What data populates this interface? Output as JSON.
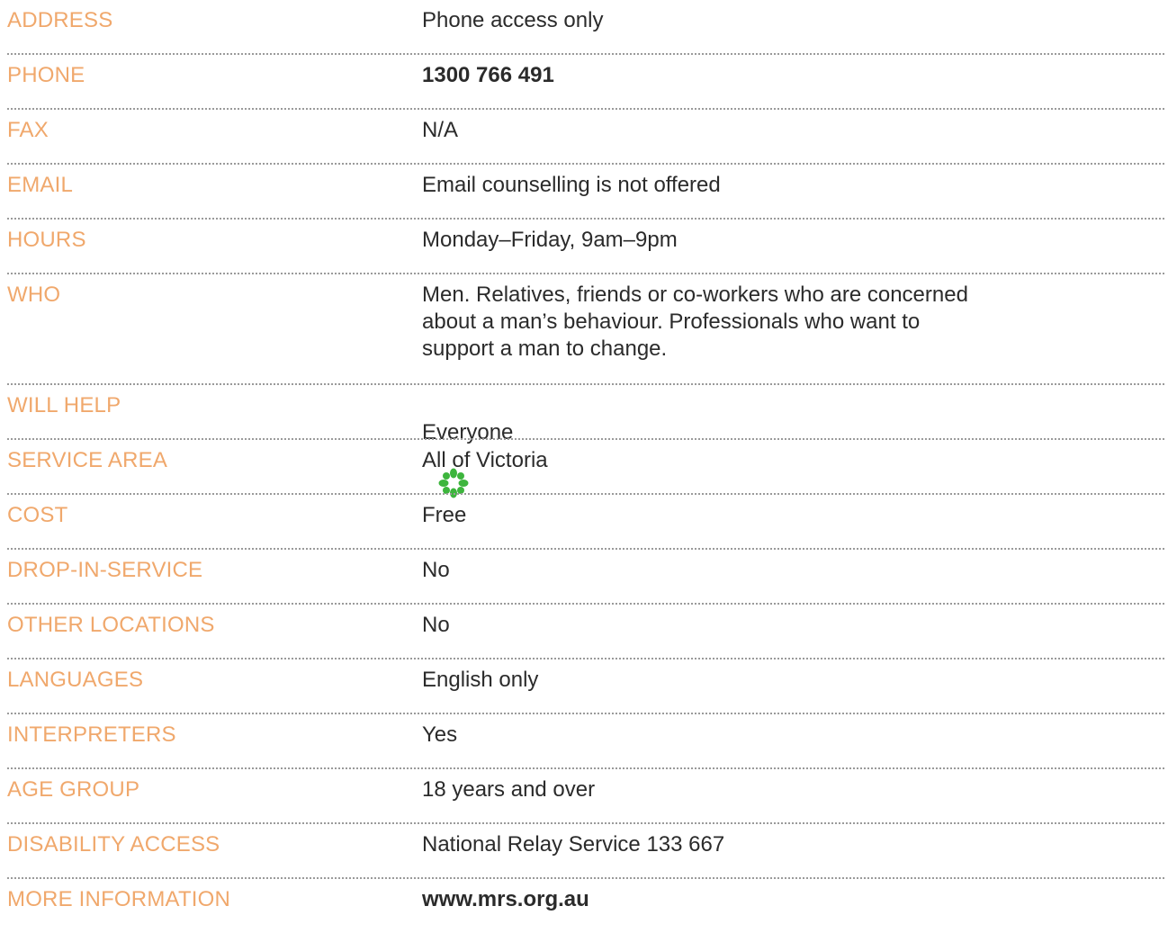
{
  "colors": {
    "label": "#f0a86c",
    "value": "#2b2b2b",
    "separator": "#9a9a9a",
    "icon": "#3db53d"
  },
  "rows": [
    {
      "label": "ADDRESS",
      "value": "Phone access only"
    },
    {
      "label": "PHONE",
      "value": "1300 766 491"
    },
    {
      "label": "FAX",
      "value": "N/A"
    },
    {
      "label": "EMAIL",
      "value": "Email counselling is not offered"
    },
    {
      "label": "HOURS",
      "value": "Monday–Friday, 9am–9pm"
    },
    {
      "label": "WHO",
      "value": "Men. Relatives, friends or co-workers who are concerned\nabout a man’s behaviour. Professionals who want to\nsupport a man to change."
    },
    {
      "label": "WILL HELP",
      "value": "Everyone",
      "icon": "green-asterisk-flower-icon"
    },
    {
      "label": "SERVICE AREA",
      "value": "All of Victoria"
    },
    {
      "label": "COST",
      "value": "Free"
    },
    {
      "label": "DROP-IN-SERVICE",
      "value": "No"
    },
    {
      "label": "OTHER LOCATIONS",
      "value": "No"
    },
    {
      "label": "LANGUAGES",
      "value": "English only"
    },
    {
      "label": "INTERPRETERS",
      "value": "Yes"
    },
    {
      "label": "AGE GROUP",
      "value": "18 years and over"
    },
    {
      "label": "DISABILITY ACCESS",
      "value": "National Relay Service 133 667"
    },
    {
      "label": "MORE INFORMATION",
      "value": "www.mrs.org.au"
    }
  ]
}
